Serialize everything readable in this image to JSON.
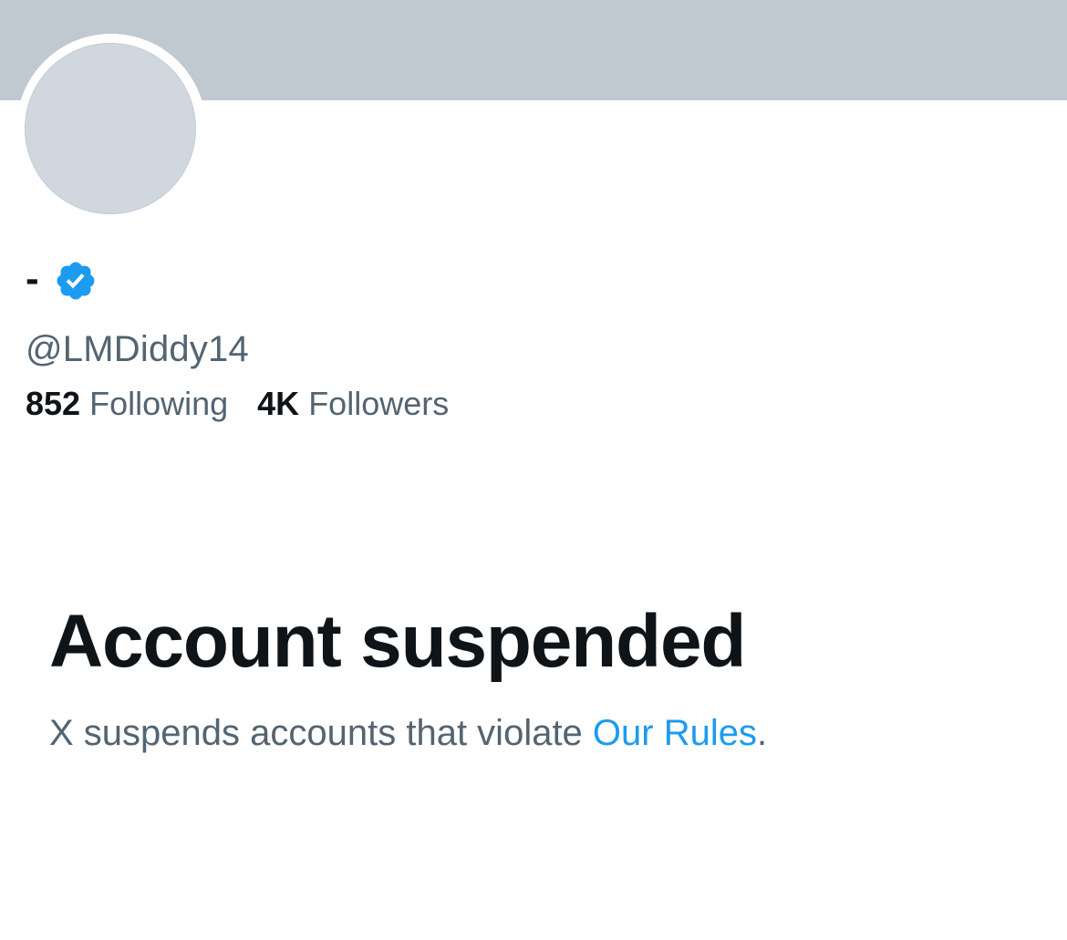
{
  "profile": {
    "display_name": "-",
    "handle": "@LMDiddy14",
    "verified": true,
    "verified_icon": "verified-badge-icon",
    "following_count": "852",
    "following_label": "Following",
    "followers_count": "4K",
    "followers_label": "Followers"
  },
  "suspension": {
    "title": "Account suspended",
    "message": "X suspends accounts that violate ",
    "rules_link": "Our Rules",
    "period": "."
  },
  "colors": {
    "banner": "#c0c9d1",
    "avatar_placeholder": "#d0d7de",
    "text_primary": "#0f1419",
    "text_secondary": "#536471",
    "link": "#1d9bf0",
    "verified_badge": "#1d9bf0"
  }
}
